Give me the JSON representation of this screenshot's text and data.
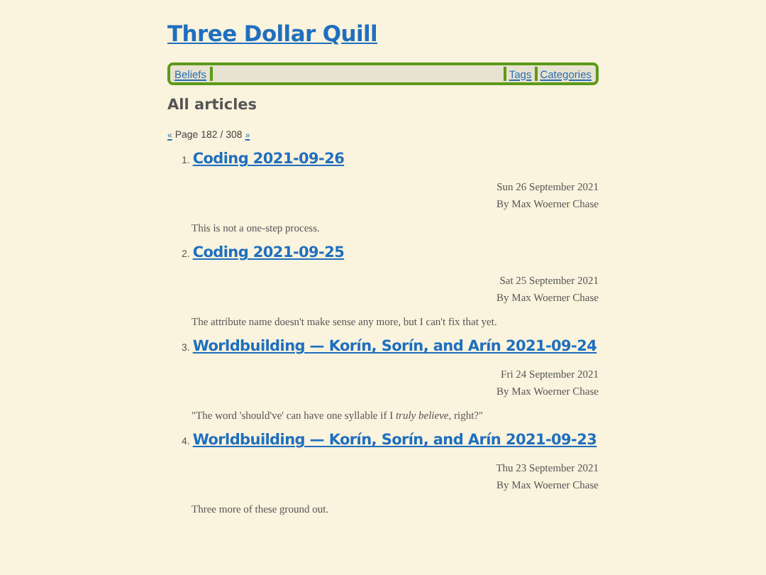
{
  "site_title": "Three Dollar Quill",
  "nav": {
    "left": [
      {
        "label": "Beliefs"
      }
    ],
    "right": [
      {
        "label": "Tags"
      },
      {
        "label": "Categories"
      }
    ]
  },
  "heading": "All articles",
  "pager": {
    "prev": "«",
    "text": "Page 182 / 308",
    "next": "»"
  },
  "articles": [
    {
      "number": "1.",
      "title": "Coding 2021-09-26",
      "date": "Sun 26 September 2021",
      "author": "By Max Woerner Chase",
      "summary": "This is not a one-step process."
    },
    {
      "number": "2.",
      "title": "Coding 2021-09-25",
      "date": "Sat 25 September 2021",
      "author": "By Max Woerner Chase",
      "summary": "The attribute name doesn't make sense any more, but I can't fix that yet."
    },
    {
      "number": "3.",
      "title": "Worldbuilding — Korín, Sorín, and Arín 2021-09-24",
      "date": "Fri 24 September 2021",
      "author": "By Max Woerner Chase",
      "summary": "\"The word 'should've' can have one syllable if I *truly believe*, right?\""
    },
    {
      "number": "4.",
      "title": "Worldbuilding — Korín, Sorín, and Arín 2021-09-23",
      "date": "Thu 23 September 2021",
      "author": "By Max Woerner Chase",
      "summary": "Three more of these ground out."
    }
  ]
}
